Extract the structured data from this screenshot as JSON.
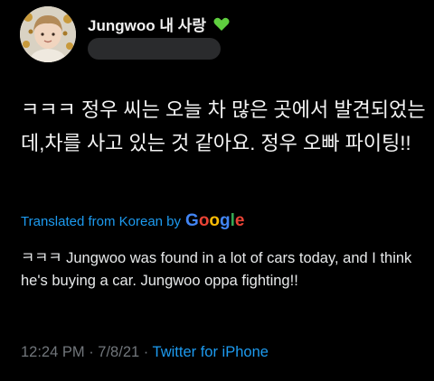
{
  "header": {
    "display_name": "Jungwoo 내 사랑",
    "heart_icon": "green-heart-icon",
    "heart_color": "#5fcf3f"
  },
  "tweet": {
    "text": "ㅋㅋㅋ 정우 씨는 오늘 차 많은 곳에서 발견되었는데,차를 사고 있는 것 같아요. 정우 오빠 파이팅!!"
  },
  "translation": {
    "label": "Translated from Korean by",
    "provider_letters": [
      "G",
      "o",
      "o",
      "g",
      "l",
      "e"
    ],
    "text": "ㅋㅋㅋ Jungwoo was found in a lot of cars today, and I think he's buying a car. Jungwoo oppa fighting!!"
  },
  "meta": {
    "time": "12:24 PM",
    "separator": " · ",
    "date": "7/8/21",
    "source": "Twitter for iPhone"
  },
  "colors": {
    "background": "#000000",
    "link": "#1d9bf0",
    "muted": "#71767b"
  }
}
